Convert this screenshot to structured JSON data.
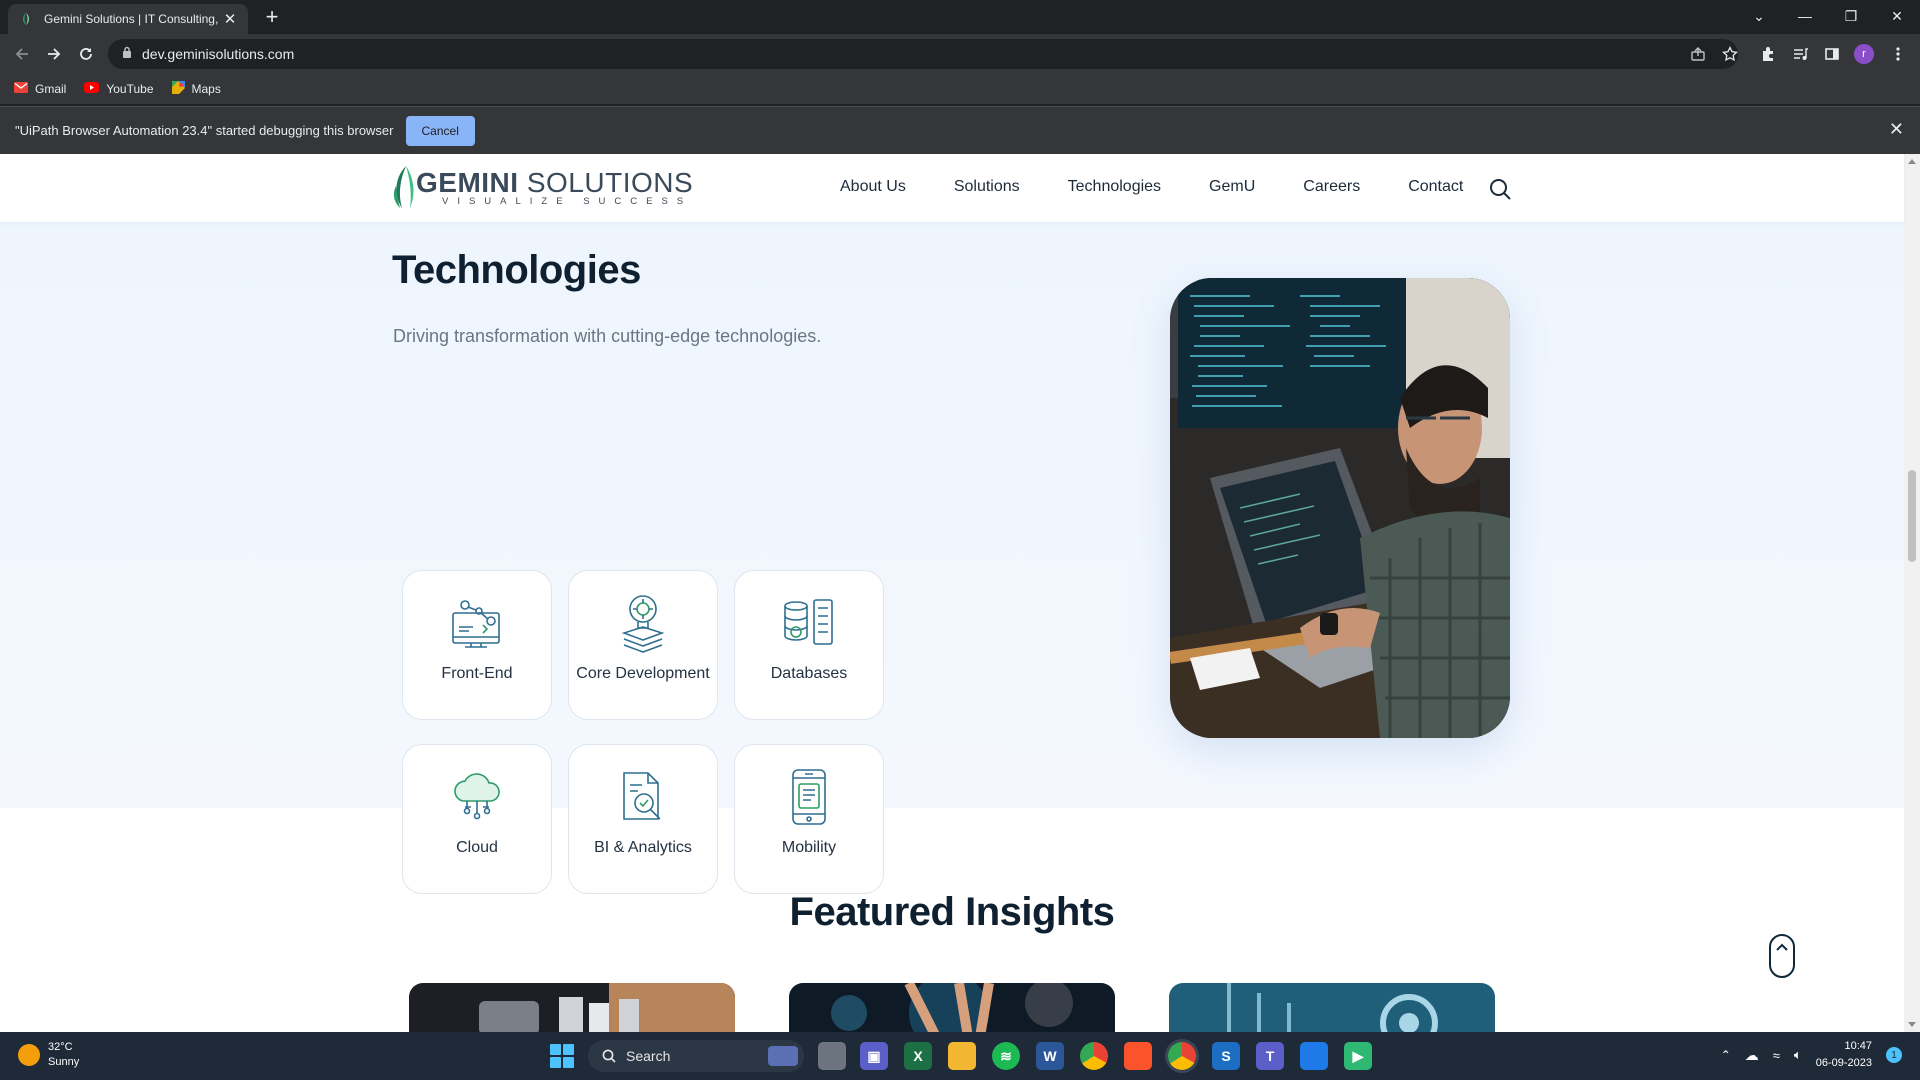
{
  "browser": {
    "tab_title": "Gemini Solutions | IT Consulting,",
    "url": "dev.geminisolutions.com",
    "bookmarks": [
      "Gmail",
      "YouTube",
      "Maps"
    ],
    "debug_message": "\"UiPath Browser Automation 23.4\" started debugging this browser",
    "debug_cancel": "Cancel",
    "profile_initial": "r"
  },
  "site": {
    "logo_word_bold": "GEMINI",
    "logo_word_light": " SOLUTIONS",
    "logo_tagline": "VISUALIZE SUCCESS",
    "nav": [
      "About Us",
      "Solutions",
      "Technologies",
      "GemU",
      "Careers",
      "Contact"
    ],
    "tech_title": "Technologies",
    "tech_subtitle": "Driving transformation with cutting-edge technologies.",
    "cards": [
      "Front-End",
      "Core Development",
      "Databases",
      "Cloud",
      "BI & Analytics",
      "Mobility"
    ],
    "insights_title": "Featured Insights"
  },
  "taskbar": {
    "temp": "32°C",
    "condition": "Sunny",
    "search_label": "Search",
    "time": "10:47",
    "date": "06-09-2023",
    "notif_count": "1"
  },
  "colors": {
    "accent": "#2f6f8f",
    "brand_green": "#2e9c6a",
    "debug_button": "#8ab4f8"
  }
}
